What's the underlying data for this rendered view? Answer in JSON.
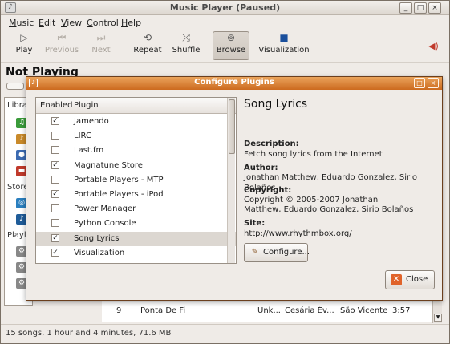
{
  "window": {
    "title": "Music Player (Paused)",
    "minimize": "_",
    "maximize": "□",
    "close": "×"
  },
  "menu": [
    "Music",
    "Edit",
    "View",
    "Control",
    "Help"
  ],
  "toolbar": {
    "play": "Play",
    "previous": "Previous",
    "next": "Next",
    "repeat": "Repeat",
    "shuffle": "Shuffle",
    "browse": "Browse",
    "visualization": "Visualization"
  },
  "now_playing": "Not Playing",
  "sidebar": {
    "library": "Libra",
    "stores": "Store",
    "playlists": "Playli"
  },
  "track": {
    "number": "9",
    "title": "Ponta De Fi",
    "genre": "Unk...",
    "artist": "Cesária Év...",
    "album": "São Vicente",
    "duration": "3:57"
  },
  "status": "15 songs, 1 hour and 4 minutes, 71.6 MB",
  "dialog": {
    "title": "Configure Plugins",
    "columns": {
      "enabled": "Enabled",
      "plugin": "Plugin"
    },
    "plugins": [
      {
        "name": "Jamendo",
        "enabled": true
      },
      {
        "name": "LIRC",
        "enabled": false
      },
      {
        "name": "Last.fm",
        "enabled": false
      },
      {
        "name": "Magnatune Store",
        "enabled": true
      },
      {
        "name": "Portable Players - MTP",
        "enabled": false
      },
      {
        "name": "Portable Players - iPod",
        "enabled": true
      },
      {
        "name": "Power Manager",
        "enabled": false
      },
      {
        "name": "Python Console",
        "enabled": false
      },
      {
        "name": "Song Lyrics",
        "enabled": true,
        "selected": true
      },
      {
        "name": "Visualization",
        "enabled": true
      }
    ],
    "detail": {
      "name": "Song Lyrics",
      "description_label": "Description:",
      "description": "Fetch song lyrics from the Internet",
      "author_label": "Author:",
      "author": "Jonathan Matthew, Eduardo Gonzalez, Sirio Bolaños",
      "copyright_label": "Copyright:",
      "copyright_line1": "Copyright © 2005-2007 Jonathan",
      "copyright_line2": "Matthew, Eduardo Gonzalez, Sirio Bolaños",
      "site_label": "Site:",
      "site": "http://www.rhythmbox.org/"
    },
    "configure_button": "Configure...",
    "close_button": "Close"
  }
}
